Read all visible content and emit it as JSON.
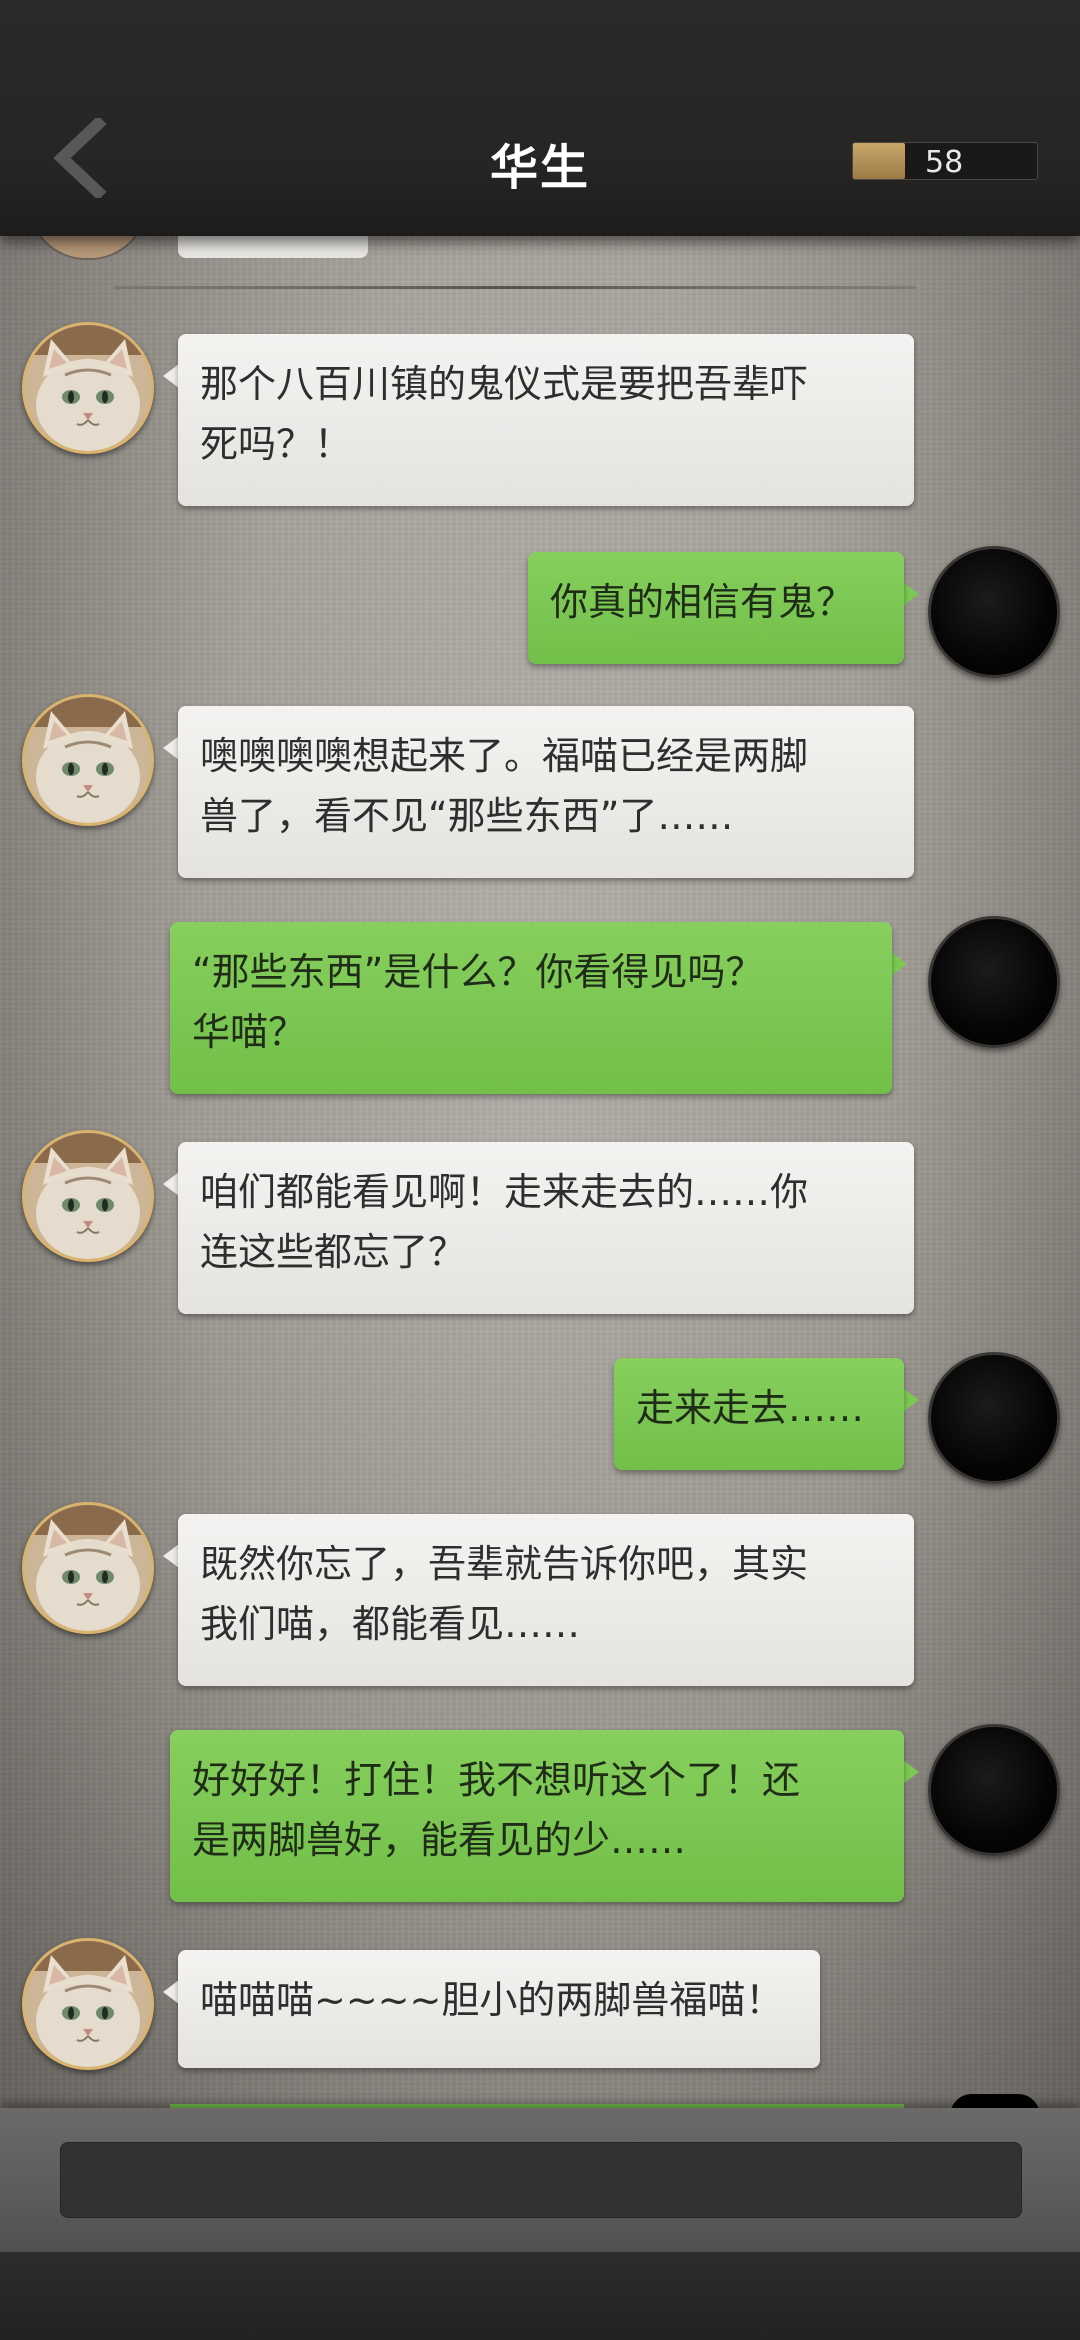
{
  "header": {
    "title": "华生",
    "coin_count": "58",
    "back_icon": "chevron-left-icon"
  },
  "colors": {
    "header_bg": "#262524",
    "bubble_left": "#efedeb",
    "bubble_right": "#7dc853",
    "coin_bar": "#b89256"
  },
  "messages": [
    {
      "side": "left",
      "avatar": "cat-avatar",
      "lines": [
        "那个八百川镇的鬼仪式是要把吾辈吓",
        "死吗？！"
      ]
    },
    {
      "side": "right",
      "avatar": "dark-avatar",
      "lines": [
        "你真的相信有鬼？"
      ]
    },
    {
      "side": "left",
      "avatar": "cat-avatar",
      "lines": [
        "噢噢噢噢想起来了。福喵已经是两脚",
        "兽了，看不见“那些东西”了……"
      ]
    },
    {
      "side": "right",
      "avatar": "dark-avatar",
      "lines": [
        "“那些东西”是什么？你看得见吗？",
        "华喵？"
      ]
    },
    {
      "side": "left",
      "avatar": "cat-avatar",
      "lines": [
        "咱们都能看见啊！走来走去的……你",
        "连这些都忘了？"
      ]
    },
    {
      "side": "right",
      "avatar": "dark-avatar",
      "lines": [
        "走来走去……"
      ]
    },
    {
      "side": "left",
      "avatar": "cat-avatar",
      "lines": [
        "既然你忘了，吾辈就告诉你吧，其实",
        "我们喵，都能看见……"
      ]
    },
    {
      "side": "right",
      "avatar": "dark-avatar",
      "lines": [
        "好好好！打住！我不想听这个了！还",
        "是两脚兽好，能看见的少……"
      ]
    },
    {
      "side": "left",
      "avatar": "cat-avatar",
      "lines": [
        "喵喵喵~~~~胆小的两脚兽福喵！"
      ]
    }
  ]
}
